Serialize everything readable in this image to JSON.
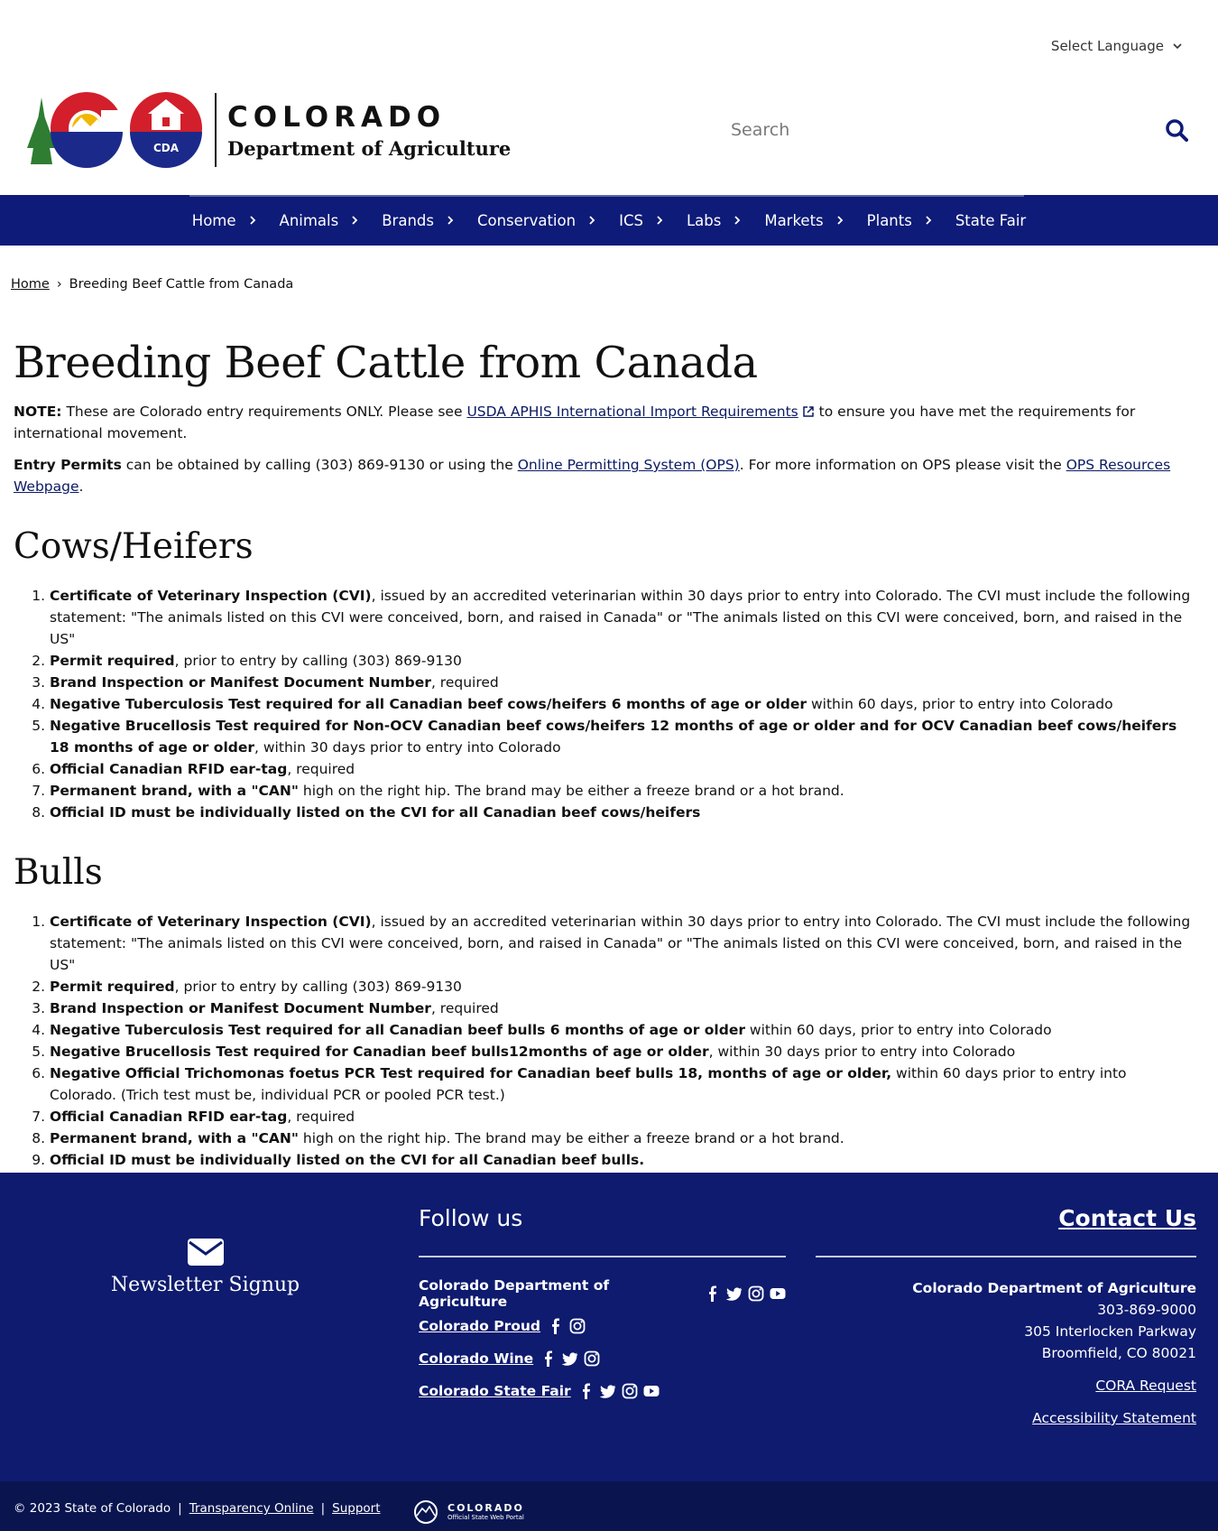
{
  "header": {
    "language_label": "Select Language",
    "logo_line1": "COLORADO",
    "logo_line2": "Department of Agriculture",
    "logo_badge": "CDA",
    "search_placeholder": "Search"
  },
  "nav": {
    "items": [
      "Home",
      "Animals",
      "Brands",
      "Conservation",
      "ICS",
      "Labs",
      "Markets",
      "Plants",
      "State Fair"
    ]
  },
  "breadcrumb": {
    "home": "Home",
    "current": "Breeding Beef Cattle from Canada"
  },
  "page": {
    "title": "Breeding Beef Cattle from Canada",
    "note_label": "NOTE:",
    "note_text_before": " These are Colorado entry requirements ONLY.  Please see ",
    "note_link": "USDA APHIS International Import Requirements",
    "note_text_after": " to ensure you have met the requirements for international movement.",
    "permits_label": "Entry Permits",
    "permits_text_before": " can be obtained by calling (303) 869-9130 or using the ",
    "permits_link": "Online Permitting System (OPS)",
    "permits_text_middle": ". For more information on OPS please visit the ",
    "permits_link2": "OPS Resources Webpage",
    "permits_text_after": "."
  },
  "cows": {
    "heading": "Cows/Heifers",
    "items": [
      {
        "bold": "Certificate of Veterinary Inspection (CVI)",
        "text": ", issued by an accredited veterinarian within 30 days prior to entry into Colorado. The CVI must include the following statement: \"The animals listed on this CVI were conceived, born, and raised in Canada\" or \"The animals listed on this CVI were conceived, born, and raised in the US\""
      },
      {
        "bold": "Permit required",
        "text": ", prior to entry by calling (303) 869-9130"
      },
      {
        "bold": "Brand Inspection or Manifest Document Number",
        "text": ", required"
      },
      {
        "bold": "Negative Tuberculosis Test required for all Canadian beef cows/heifers 6 months of age or older",
        "text": " within 60 days, prior to entry into Colorado"
      },
      {
        "bold": "Negative Brucellosis Test required for Non-OCV Canadian beef cows/heifers 12 months of age or older and for OCV Canadian beef cows/heifers 18 months of age or older",
        "text": ", within 30 days prior to entry into Colorado"
      },
      {
        "bold": "Official Canadian RFID ear-tag",
        "text": ", required"
      },
      {
        "bold": "Permanent brand, with a \"CAN\"",
        "text": " high on the right hip. The brand may be either a freeze brand or a hot brand."
      },
      {
        "bold": "Official ID must be individually listed on the CVI for all Canadian beef cows/heifers",
        "text": ""
      }
    ]
  },
  "bulls": {
    "heading": "Bulls",
    "items": [
      {
        "bold": "Certificate of Veterinary Inspection (CVI)",
        "text": ", issued by an accredited veterinarian within 30 days prior to entry into Colorado. The CVI must include the following statement: \"The animals listed on this CVI were conceived, born, and raised in Canada\" or \"The animals listed on this CVI were conceived, born, and raised in the US\""
      },
      {
        "bold": "Permit required",
        "text": ", prior to entry by calling (303) 869-9130"
      },
      {
        "bold": "Brand Inspection or Manifest Document Number",
        "text": ", required"
      },
      {
        "bold": "Negative Tuberculosis Test required for all Canadian beef bulls 6 months of age or older",
        "text": " within 60 days, prior to entry into Colorado"
      },
      {
        "bold": "Negative Brucellosis Test required for Canadian beef bulls12months of age or older",
        "text": ", within 30 days prior to entry into Colorado"
      },
      {
        "bold": "Negative Official Trichomonas foetus PCR Test required for Canadian beef bulls 18, months of age or older,",
        "text": " within 60 days prior to entry into Colorado. (Trich test must be, individual PCR or pooled PCR test.)"
      },
      {
        "bold": "Official Canadian RFID ear-tag",
        "text": ", required"
      },
      {
        "bold": "Permanent brand, with a \"CAN\"",
        "text": " high on the right hip. The brand may be either a freeze brand or a hot brand."
      },
      {
        "bold": "Official ID must be individually listed on the CVI for all Canadian beef bulls.",
        "text": ""
      }
    ]
  },
  "footer": {
    "newsletter": "Newsletter Signup",
    "follow_heading": "Follow us",
    "social": [
      {
        "label": "Colorado Department of Agriculture",
        "icons": [
          "facebook-icon",
          "twitter-icon",
          "instagram-icon",
          "youtube-icon"
        ]
      },
      {
        "label": "Colorado Proud",
        "icons": [
          "facebook-icon",
          "instagram-icon"
        ]
      },
      {
        "label": "Colorado Wine",
        "icons": [
          "facebook-icon",
          "twitter-icon",
          "instagram-icon"
        ]
      },
      {
        "label": "Colorado State Fair",
        "icons": [
          "facebook-icon",
          "twitter-icon",
          "instagram-icon",
          "youtube-icon"
        ]
      }
    ],
    "contact_heading": "Contact Us",
    "org": "Colorado Department of Agriculture",
    "phone": "303-869-9000",
    "address1": "305 Interlocken Parkway",
    "address2": "Broomfield, CO 80021",
    "cora": "CORA Request",
    "accessibility": "Accessibility Statement",
    "copyright": "© 2023 State of Colorado",
    "separator": "|",
    "transparency": "Transparency Online",
    "support": "Support",
    "portal_line1": "COLORADO",
    "portal_line2": "Official State Web Portal"
  },
  "colors": {
    "nav_bg": "#0e1b78",
    "footer_bg": "#0e1b6e",
    "footer_bottom_bg": "#0a1550",
    "link": "#0a1a63"
  }
}
